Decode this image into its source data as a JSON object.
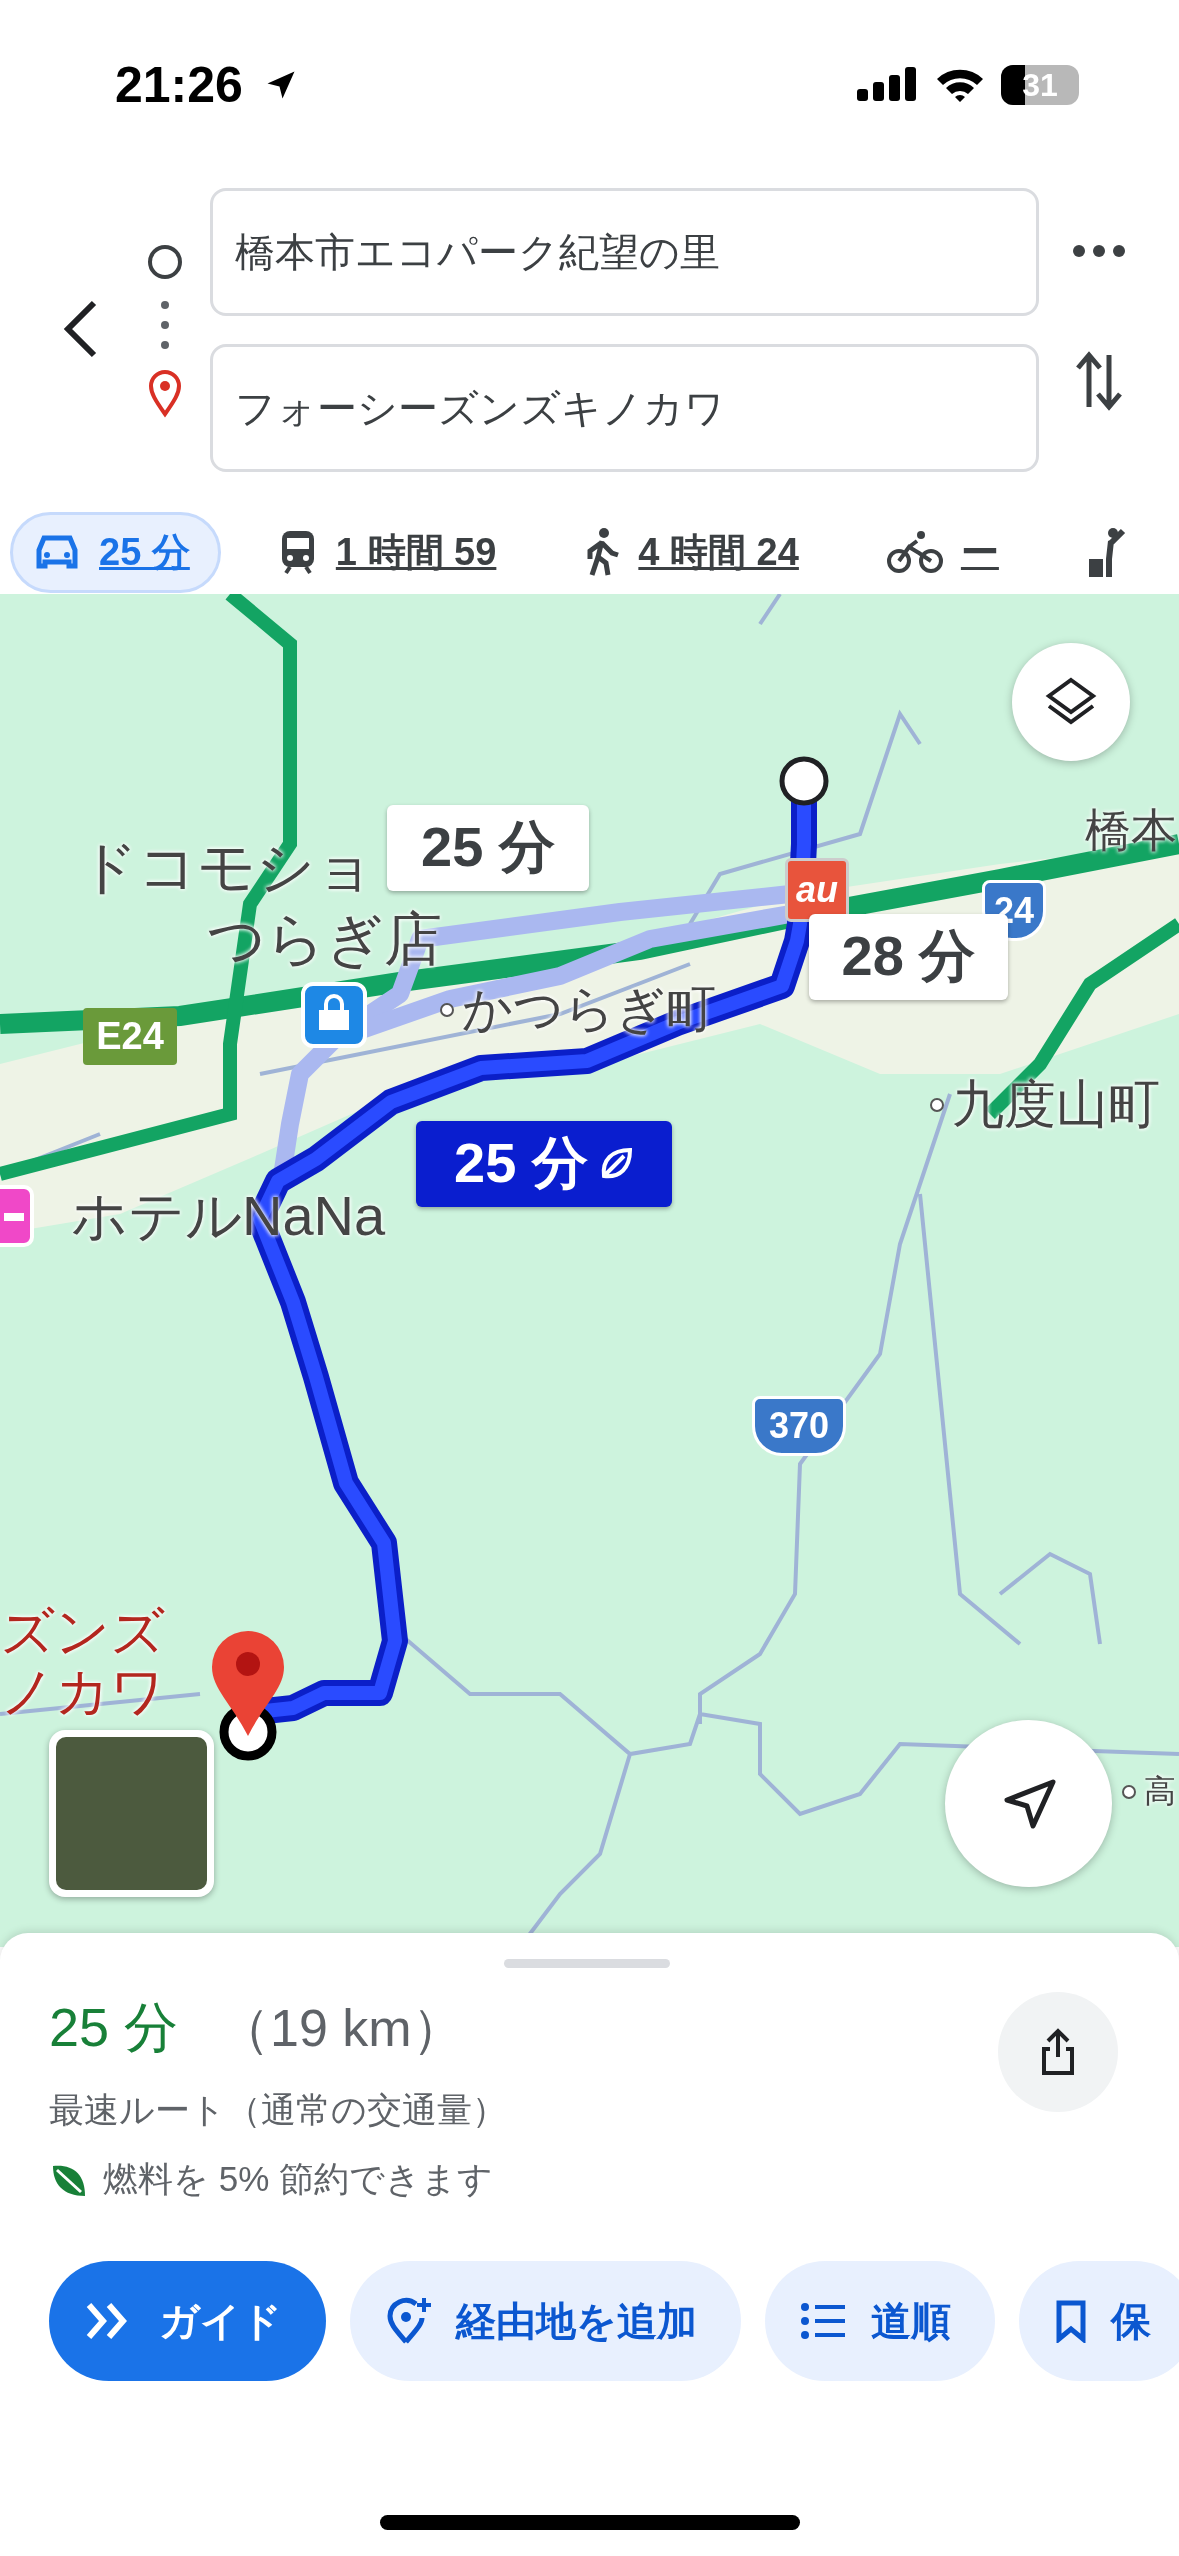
{
  "status_bar": {
    "time": "21:26",
    "battery": "31"
  },
  "directions": {
    "origin": {
      "value": "橋本市エコパーク紀望の里"
    },
    "destination": {
      "value": "フォーシーズンズキノカワ"
    }
  },
  "travel_modes": [
    {
      "kind": "car",
      "label": "25 分",
      "selected": true
    },
    {
      "kind": "transit",
      "label": "1 時間 59",
      "selected": false
    },
    {
      "kind": "walk",
      "label": "4 時間 24",
      "selected": false
    },
    {
      "kind": "bike",
      "label": "ー",
      "selected": false
    },
    {
      "kind": "ride",
      "selected": false
    }
  ],
  "map": {
    "place_labels": [
      {
        "kind": "poi",
        "text": "ドコモショ"
      },
      {
        "kind": "poi",
        "text": "つらぎ店"
      },
      {
        "kind": "town",
        "text": "かつらぎ町"
      },
      {
        "kind": "place",
        "text": "橋本"
      },
      {
        "kind": "town",
        "text": "九度山町"
      },
      {
        "kind": "poi",
        "text": "ホテルNaNa"
      },
      {
        "kind": "destination",
        "text": "ズンズ"
      },
      {
        "kind": "destination",
        "text": "ノカワ"
      },
      {
        "kind": "town",
        "text": "高"
      }
    ],
    "road_shields": [
      {
        "kind": "expressway",
        "text": "E24"
      },
      {
        "kind": "national",
        "text": "24"
      },
      {
        "kind": "national",
        "text": "370"
      }
    ],
    "shop_badge": "au",
    "route_callouts": [
      {
        "label": "25 分",
        "selected": false,
        "eco": false
      },
      {
        "label": "28 分",
        "selected": false,
        "eco": false
      },
      {
        "label": "25 分",
        "selected": true,
        "eco": true
      }
    ]
  },
  "summary": {
    "duration": "25 分",
    "distance": "（19 km）",
    "route_note": "最速ルート（通常の交通量）",
    "eco_note": "燃料を 5% 節約できます"
  },
  "actions": [
    {
      "kind": "guide",
      "label": "ガイド",
      "primary": true
    },
    {
      "kind": "add-stop",
      "label": "経由地を追加",
      "primary": false
    },
    {
      "kind": "steps",
      "label": "道順",
      "primary": false
    },
    {
      "kind": "save",
      "label": "保",
      "primary": false
    }
  ]
}
